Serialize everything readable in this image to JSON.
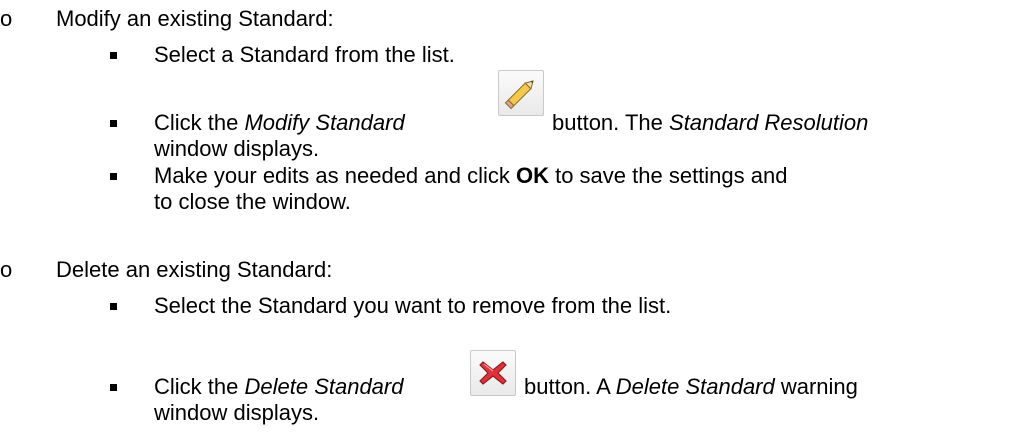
{
  "section_modify": {
    "heading_marker": "o",
    "heading": "Modify an existing Standard:",
    "steps": [
      {
        "text": "Select a Standard from the list."
      },
      {
        "prefix": "Click the ",
        "italic_name": "Modify Standard",
        "icon": "pencil-icon",
        "after_icon": " button. The ",
        "italic_window": "Standard Resolution",
        "line2": "window displays."
      },
      {
        "prefix": "Make your edits as needed and click ",
        "bold": "OK",
        "suffix": " to save the settings and",
        "line2": "to close the window."
      }
    ]
  },
  "section_delete": {
    "heading_marker": "o",
    "heading": "Delete an existing Standard:",
    "steps": [
      {
        "text": "Select the Standard you want to remove from the list."
      },
      {
        "prefix": "Click the ",
        "italic_name": "Delete Standard",
        "icon": "red-x-icon",
        "after_icon": " button. A ",
        "italic_window": "Delete Standard",
        "suffix": " warning",
        "line2": "window displays."
      }
    ]
  },
  "colors": {
    "text": "#000000",
    "pencil_body": "#f2c94c",
    "delete_x": "#e0303a"
  }
}
